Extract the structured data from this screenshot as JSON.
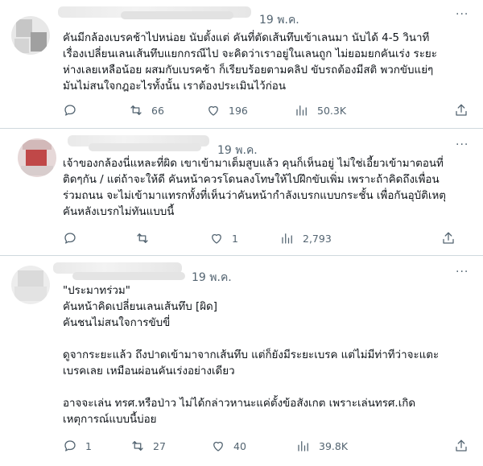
{
  "tweets": [
    {
      "date": "19 พ.ค.",
      "more": "...",
      "text": "คันมีกล้องเบรคช้าไปหน่อย นับตั้งแต่ คันที่ตัดเส้นทึบเข้าเลนมา นับได้ 4-5 วินาที\nเรื่องเปลี่ยนเลนเส้นทึบแยกกรณีไป จะคิดว่าเราอยู่ในเลนถูก ไม่ยอมยกคันเร่ง ระยะ\nห่างเลยเหลือน้อย ผสมกับเบรคช้า ก็เรียบร้อยตามคลิป  ขับรถต้องมีสติ พวกขับแย่ๆ\nมันไม่สนใจกฎอะไรทั้งนั้น เราต้องประเมินไว้ก่อน",
      "reply": "",
      "retweet": "",
      "like": "196",
      "views": "50.3K",
      "retweet_count": "66"
    },
    {
      "date": "19 พ.ค.",
      "more": "...",
      "text": "เจ้าของกล้องนี่แหละที่ผิด เขาเข้ามาเต็มสูบแล้ว คุนก็เห็นอยู่ ไม่ใช่เอี้ยวเข้ามาตอนที่\nติดๆกัน / แต่ถ้าจะให้ดี คันหน้าควรโดนลงโทษให้ไปฝึกขับเพิ่ม เพราะถ้าคิดถึงเพื่อน\nร่วมถนน จะไม่เข้ามาแทรกทั้งที่เห็นว่าคันหน้ากำลังเบรกแบบกระชั้น เพื่อกันอุบัติเหตุ\nคันหลังเบรกไม่ทันแบบนี้",
      "reply": "",
      "retweet": "",
      "like": "1",
      "views": "2,793"
    },
    {
      "date": "19 พ.ค.",
      "more": "...",
      "text": "\"ประมาทร่วม\"\nคันหน้าคิดเปลี่ยนเลนเส้นทึบ [ผิด]\nคันชนไม่สนใจการขับขี่\n\nดูจากระยะแล้ว ถึงปาดเข้ามาจากเส้นทึบ แต่ก็ยังมีระยะเบรค แต่ไม่มีท่าทีว่าจะแตะ\nเบรคเลย เหมือนผ่อนคันเร่งอย่างเดียว\n\nอาจจะเล่น ทรศ.หรือป่าว ไม่ได้กล่าวหานะแค่ตั้งข้อสังเกต เพราะเล่นทรศ.เกิด\nเหตุการณ์แบบนี้บ่อย",
      "reply": "1",
      "retweet": "27",
      "like": "40",
      "views": "39.8K"
    }
  ],
  "colors": {
    "text": "#0f1419",
    "muted": "#536471",
    "border": "#cfd9de"
  },
  "icons": [
    "reply-icon",
    "retweet-icon",
    "like-icon",
    "views-icon",
    "more-icon"
  ]
}
